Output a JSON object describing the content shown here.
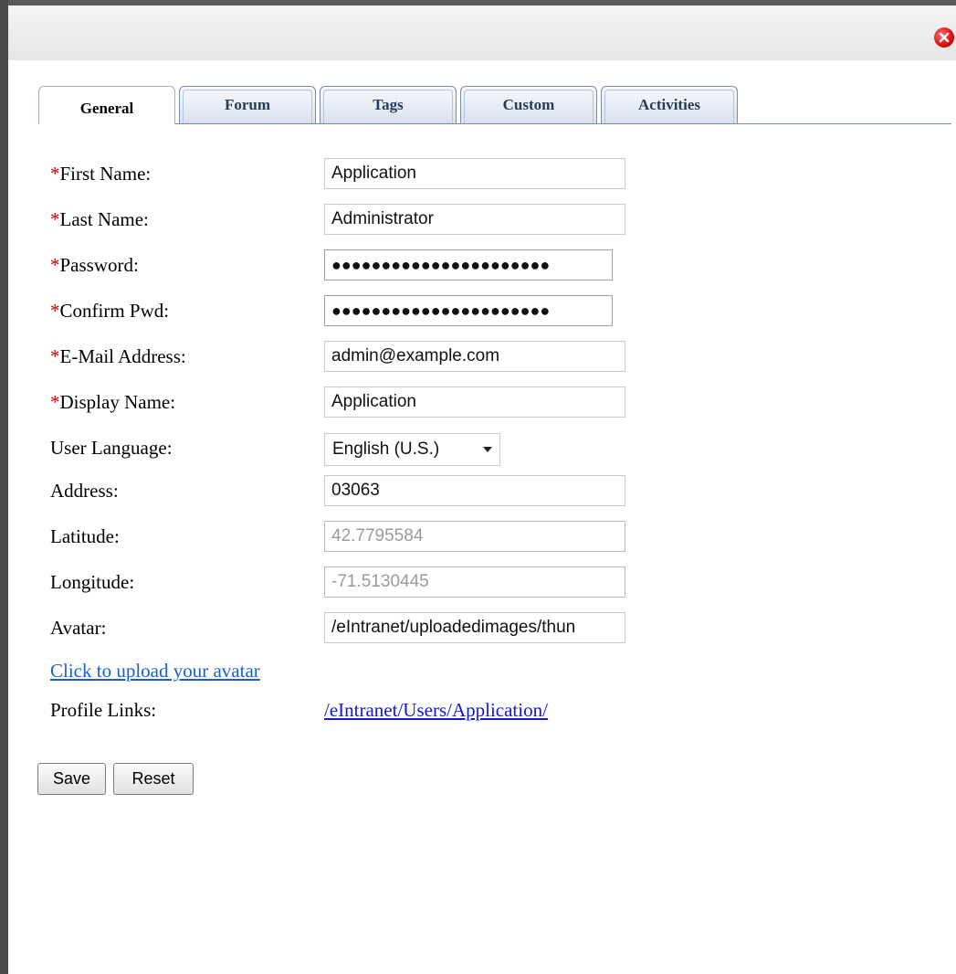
{
  "tabs": [
    "General",
    "Forum",
    "Tags",
    "Custom",
    "Activities"
  ],
  "form": {
    "first_name_label": "First Name:",
    "first_name_value": "Application",
    "last_name_label": "Last Name:",
    "last_name_value": "Administrator",
    "password_label": "Password:",
    "password_value": "●●●●●●●●●●●●●●●●●●●●●●",
    "confirm_label": "Confirm Pwd:",
    "confirm_value": "●●●●●●●●●●●●●●●●●●●●●●",
    "email_label": "E-Mail Address:",
    "email_value": "admin@example.com",
    "display_label": "Display Name:",
    "display_value": "Application",
    "language_label": "User Language:",
    "language_value": "English (U.S.)",
    "address_label": "Address:",
    "address_value": "03063",
    "latitude_label": "Latitude:",
    "latitude_value": "42.7795584",
    "longitude_label": "Longitude:",
    "longitude_value": "-71.5130445",
    "avatar_label": "Avatar:",
    "avatar_value": "/eIntranet/uploadedimages/thun",
    "upload_link": "Click to upload your avatar",
    "profile_links_label": "Profile Links:",
    "profile_link": "/eIntranet/Users/Application/"
  },
  "required_marker": "*",
  "buttons": {
    "save": "Save",
    "reset": "Reset"
  },
  "colors": {
    "required": "#cc0000",
    "link_upload": "#1a5fd0",
    "link_profile": "#1515d6"
  },
  "icons": {
    "close": "close-icon",
    "dropdown": "chevron-down-icon"
  }
}
